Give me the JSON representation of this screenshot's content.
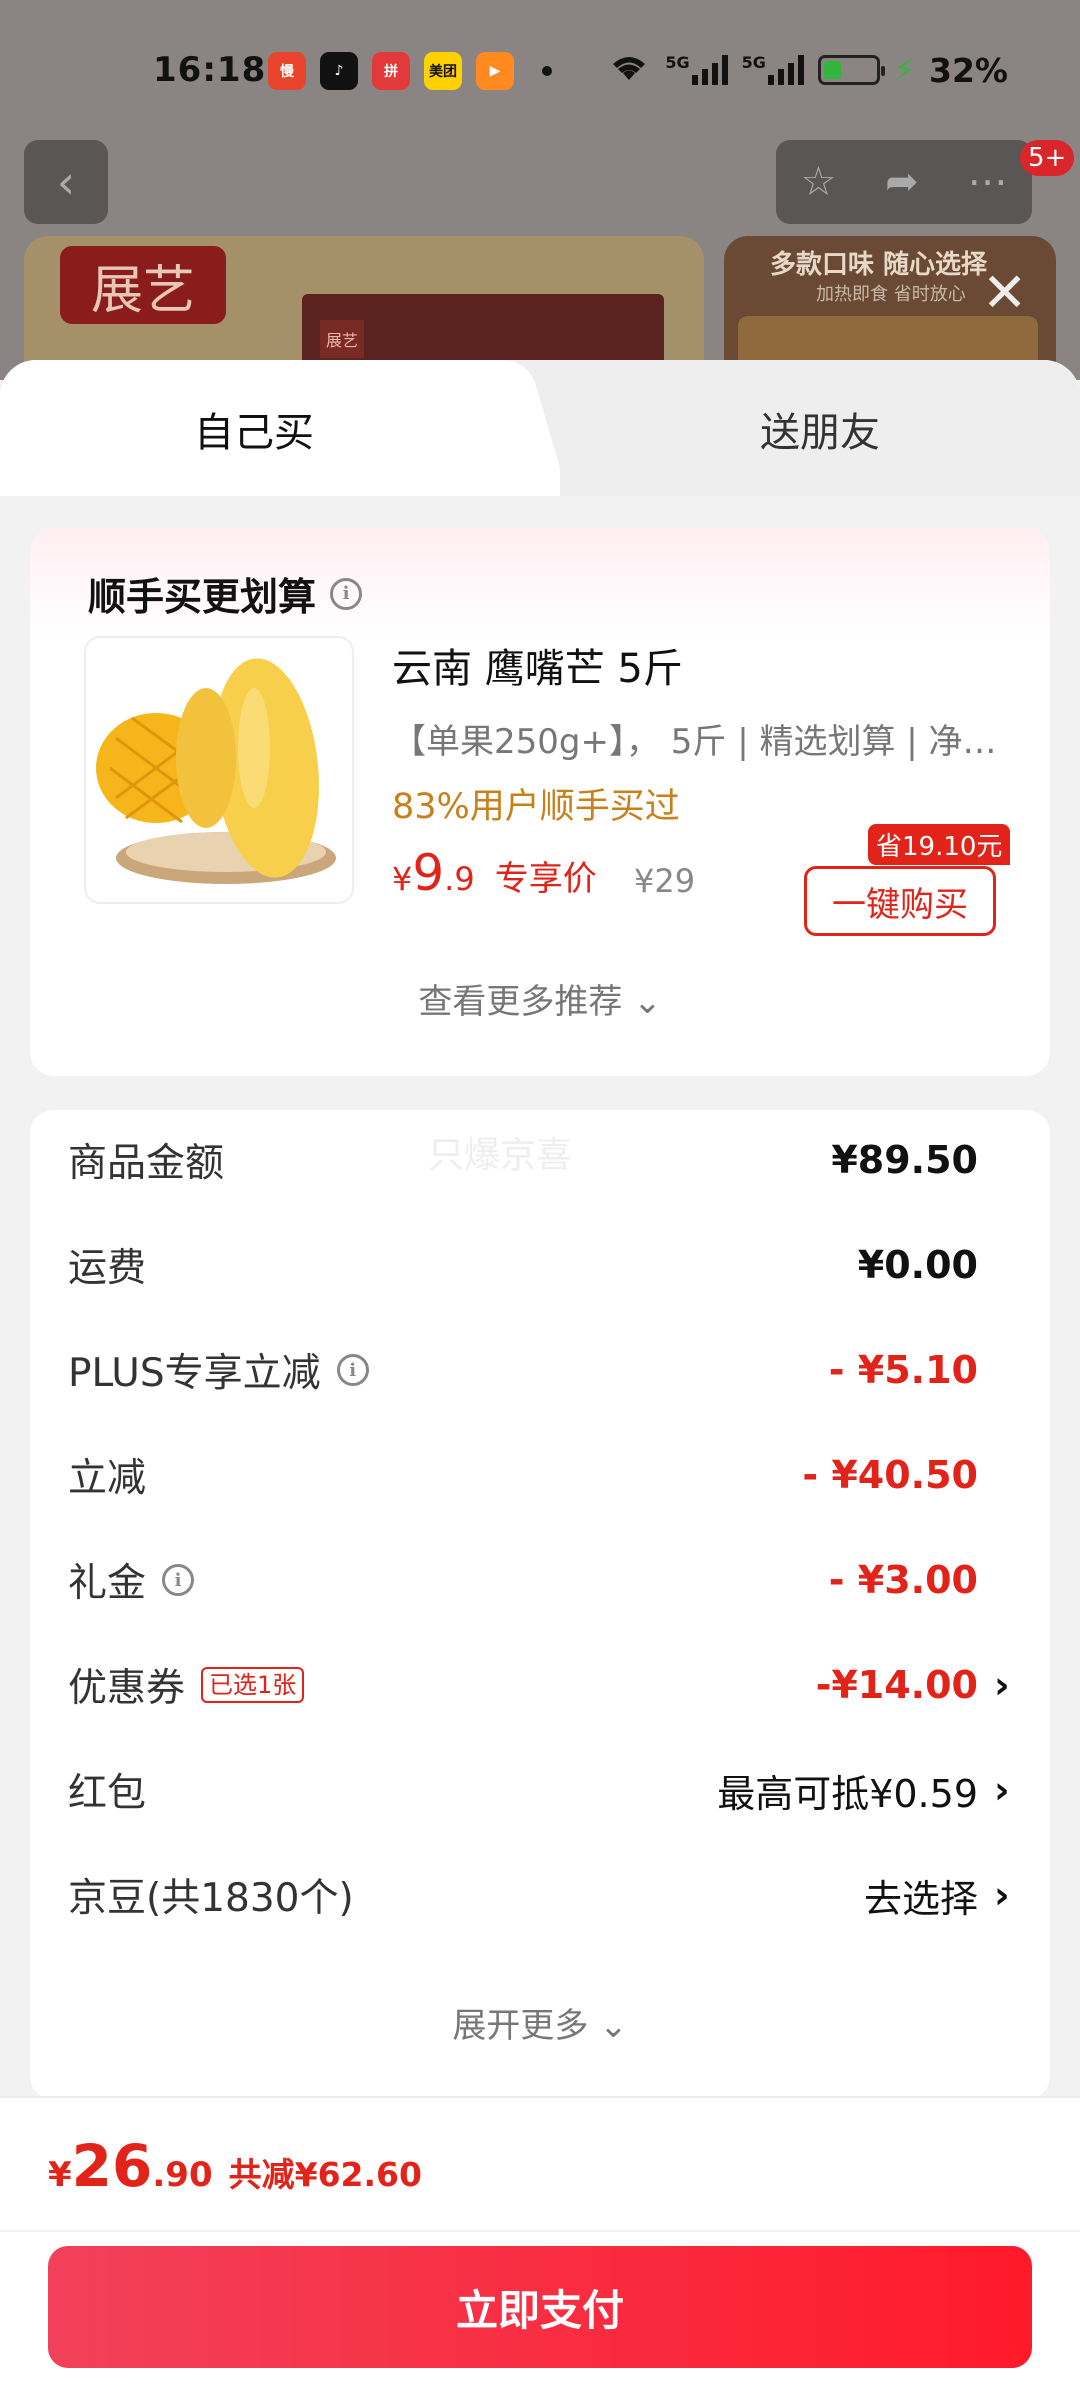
{
  "status_bar": {
    "time": "16:18",
    "app_icons": [
      {
        "name": "app-icon-1",
        "text": "慢",
        "color": "#e8452c"
      },
      {
        "name": "app-icon-2",
        "text": "♪",
        "color": "#111111"
      },
      {
        "name": "app-icon-3",
        "text": "拼",
        "color": "#e23a3a"
      },
      {
        "name": "app-icon-4",
        "text": "美团",
        "color": "#ffd100"
      },
      {
        "name": "app-icon-5",
        "text": "▶",
        "color": "#ff8a1f"
      }
    ],
    "network_1": "5G",
    "network_2": "5G",
    "battery": "32%"
  },
  "top_bar": {
    "badge": "5+"
  },
  "banner": {
    "brand": "展艺",
    "brand_small": "展艺",
    "promo_title": "多款口味 随心选择",
    "promo_sub": "加热即食 省时放心"
  },
  "tabs": {
    "self": "自己买",
    "gift": "送朋友"
  },
  "recommend": {
    "title": "顺手买更划算",
    "product_name": "云南 鹰嘴芒 5斤",
    "description": "【单果250g+】， 5斤 | 精选划算 | 净果...",
    "bought_rate": "83%用户顺手买过",
    "price_symbol": "¥",
    "price_int": "9",
    "price_dec": ".9",
    "exclusive": "专享价",
    "original_price": "¥29",
    "save_tag": "省19.10元",
    "buy_button": "一键购买",
    "more": "查看更多推荐"
  },
  "summary": {
    "watermark": "只爆京喜",
    "rows": [
      {
        "label": "商品金额",
        "value": "¥89.50"
      },
      {
        "label": "运费",
        "value": "¥0.00"
      },
      {
        "label": "PLUS专享立减",
        "value": "- ¥5.10"
      },
      {
        "label": "立减",
        "value": "- ¥40.50"
      },
      {
        "label": "礼金",
        "value": "- ¥3.00"
      },
      {
        "label": "优惠券",
        "badge": "已选1张",
        "value": "-¥14.00"
      },
      {
        "label": "红包",
        "value": "最高可抵¥0.59"
      },
      {
        "label": "京豆(共1830个)",
        "value": "去选择"
      }
    ],
    "expand": "展开更多"
  },
  "footer": {
    "total_symbol": "¥",
    "total_int": "26",
    "total_dec": ".90",
    "total_reduce": "共减¥62.60",
    "pay_button": "立即支付"
  },
  "colors": {
    "accent_red": "#e2231a",
    "orange": "#c8801a",
    "pay_gradient_start": "#f2415a",
    "pay_gradient_end": "#ff1a2a"
  }
}
